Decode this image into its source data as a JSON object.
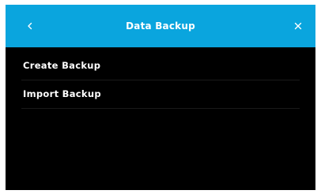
{
  "header": {
    "title": "Data Backup",
    "back_icon": "chevron-left-icon",
    "close_icon": "close-icon",
    "background_color": "#0aa5de"
  },
  "menu": {
    "items": [
      {
        "label": "Create Backup"
      },
      {
        "label": "Import Backup"
      }
    ]
  },
  "colors": {
    "screen_background": "#000000",
    "text": "#ffffff",
    "divider": "#1a1a1a"
  }
}
